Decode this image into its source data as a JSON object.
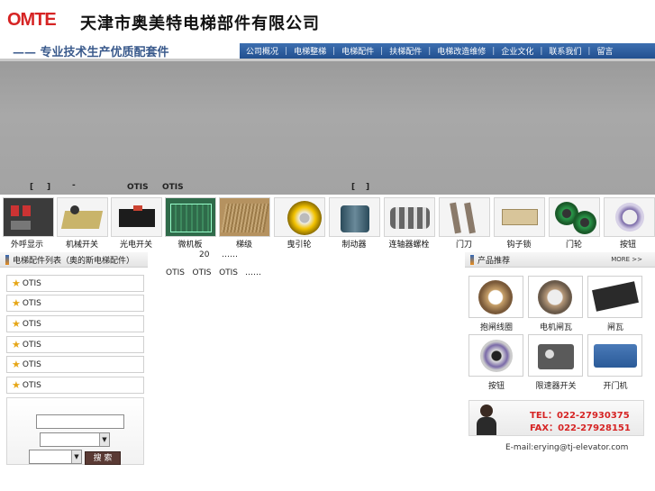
{
  "header": {
    "logo": "OMTE",
    "company": "天津市奥美特电梯部件有限公司",
    "slogan": "—— 专业技术生产优质配套件"
  },
  "nav": [
    "公司概况",
    "电梯整梯",
    "电梯配件",
    "扶梯配件",
    "电梯改造维修",
    "企业文化",
    "联系我们",
    "留言"
  ],
  "banner": {
    "t1": "[",
    "t2": "]",
    "t3": "-",
    "t4": "OTIS",
    "t5": "OTIS",
    "t6": "[",
    "t7": "]"
  },
  "products": [
    "外呼显示",
    "机械开关",
    "光电开关",
    "微机板",
    "梯级",
    "曳引轮",
    "制动器",
    "连轴器螺栓",
    "门刀",
    "钩子锁",
    "门轮",
    "按钮"
  ],
  "list_header": "电梯配件列表（奥的斯电梯配件）",
  "categories": [
    "OTIS",
    "OTIS",
    "OTIS",
    "OTIS",
    "OTIS",
    "OTIS"
  ],
  "search": {
    "button": "搜 索"
  },
  "center": {
    "count": "20",
    "dots": "……",
    "line": "OTIS   OTIS   OTIS",
    "dots2": "……"
  },
  "recommend": {
    "title": "产品推荐",
    "more": "MORE >>",
    "items": [
      "抱闸线圈",
      "电机闸瓦",
      "闸瓦",
      "按钮",
      "限速器开关",
      "开门机"
    ]
  },
  "contact": {
    "tel": "TEL：022-27930375",
    "fax": "FAX：022-27928151",
    "email": "E-mail:erying@tj-elevator.com"
  },
  "colors": {
    "nav": "#2a5a9c",
    "logo": "#d62424",
    "tel": "#d62424"
  }
}
